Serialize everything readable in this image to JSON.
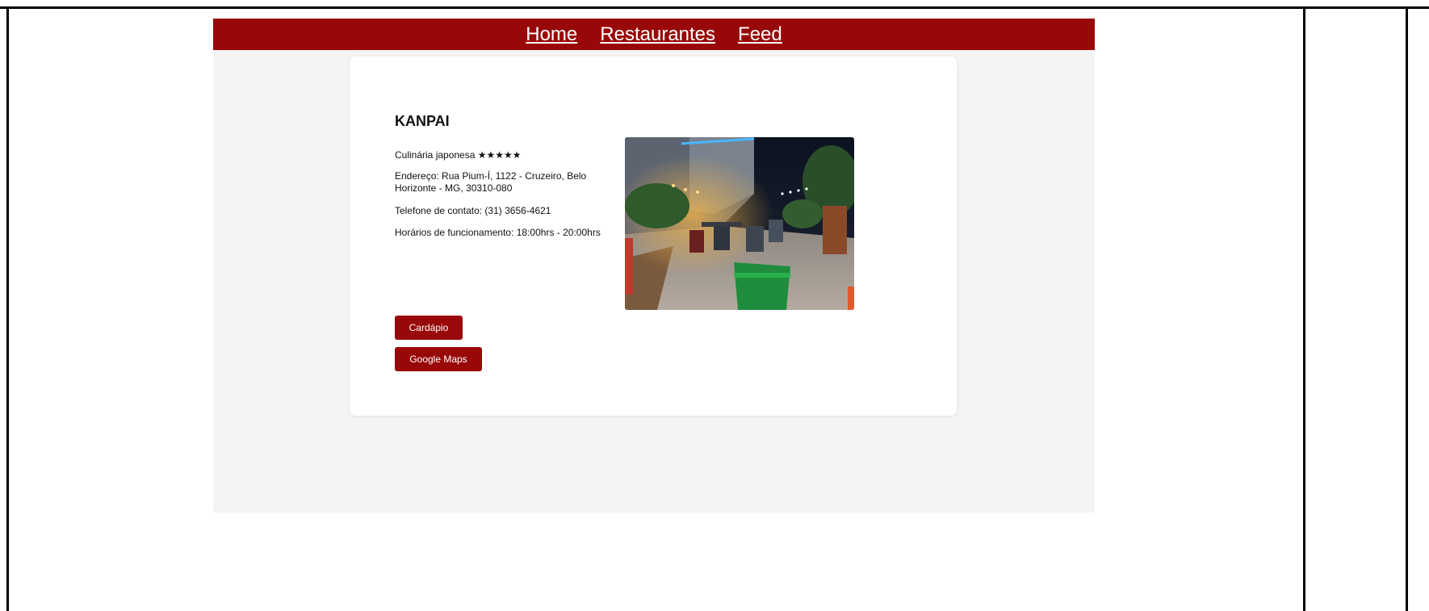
{
  "nav": {
    "links": [
      {
        "label": "Home"
      },
      {
        "label": "Restaurantes"
      },
      {
        "label": "Feed"
      }
    ]
  },
  "restaurant": {
    "name": "KANPAI",
    "cuisine": "Culinária japonesa ★★★★★",
    "address": "Endereço: Rua Pium-Í, 1122 - Cruzeiro, Belo Horizonte - MG, 30310-080",
    "phone": "Telefone de contato: (31) 3656-4621",
    "hours": "Horários de funcionamento: 18:00hrs - 20:00hrs",
    "rating_stars": 5
  },
  "buttons": {
    "menu_label": "Cardápio",
    "maps_label": "Google Maps"
  },
  "colors": {
    "brand": "#990808",
    "page_bg": "#f4f4f4",
    "card_bg": "#ffffff"
  }
}
